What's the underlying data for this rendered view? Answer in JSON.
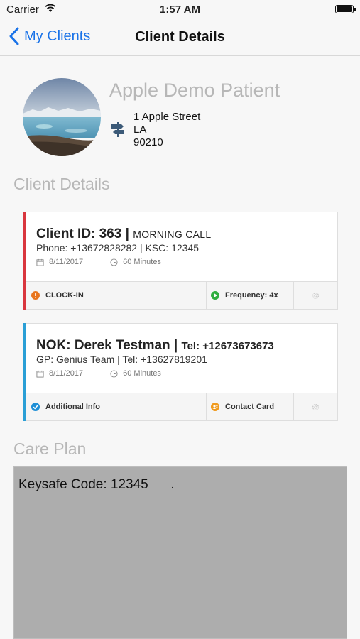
{
  "status_bar": {
    "carrier": "Carrier",
    "time": "1:57 AM"
  },
  "nav": {
    "back_label": "My Clients",
    "title": "Client Details"
  },
  "patient": {
    "name": "Apple Demo Patient",
    "address_line1": "1 Apple Street",
    "address_line2": "LA",
    "address_line3": "90210"
  },
  "sections": {
    "client_details": "Client Details",
    "care_plan": "Care Plan"
  },
  "visit_card": {
    "accent_color": "#d9363e",
    "title_main": "Client ID: 363 |",
    "title_sub": "MORNING CALL",
    "line2": "Phone: +13672828282 | KSC: 12345",
    "date": "8/11/2017",
    "duration": "60 Minutes",
    "action1": "CLOCK-IN",
    "action2": "Frequency: 4x"
  },
  "nok_card": {
    "accent_color": "#2a9fd6",
    "title_main": "NOK: Derek Testman |",
    "title_sub": "Tel: +12673673673",
    "line2": "GP: Genius Team | Tel: +13627819201",
    "date": "8/11/2017",
    "duration": "60 Minutes",
    "action1": "Additional Info",
    "action2": "Contact Card"
  },
  "care_plan": {
    "text": "Keysafe Code: 12345      ."
  },
  "icons": {
    "back": "chevron-left-icon",
    "address": "signpost-icon",
    "calendar": "calendar-icon",
    "clock": "clock-icon",
    "clock_in": "alert-circle-icon",
    "frequency": "play-circle-icon",
    "info": "check-circle-icon",
    "contact": "contact-card-icon",
    "settings": "gear-icon"
  }
}
